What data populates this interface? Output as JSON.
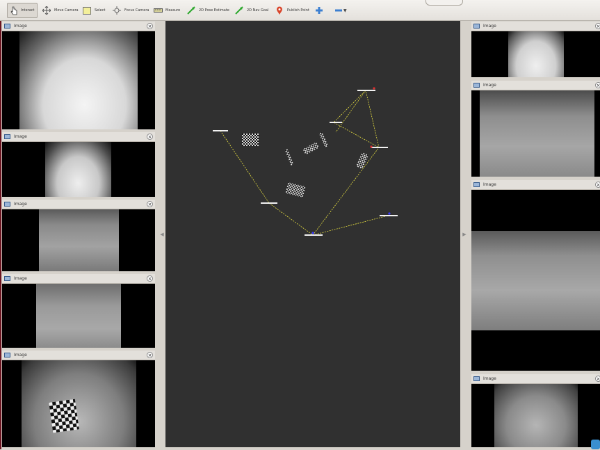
{
  "toolbar": {
    "tools": [
      {
        "label": "Interact",
        "icon": "hand-cursor-icon"
      },
      {
        "label": "Move Camera",
        "icon": "move-camera-icon"
      },
      {
        "label": "Select",
        "icon": "select-box-icon"
      },
      {
        "label": "Focus Camera",
        "icon": "focus-camera-icon"
      },
      {
        "label": "Measure",
        "icon": "ruler-icon"
      },
      {
        "label": "2D Pose Estimate",
        "icon": "green-arrow-icon"
      },
      {
        "label": "2D Nav Goal",
        "icon": "green-arrow-icon"
      },
      {
        "label": "Publish Point",
        "icon": "map-pin-icon"
      }
    ],
    "active": "Interact"
  },
  "panels": {
    "left": [
      {
        "title": "Image"
      },
      {
        "title": "Image"
      },
      {
        "title": "Image"
      },
      {
        "title": "Image"
      },
      {
        "title": "Image"
      }
    ],
    "right": [
      {
        "title": "Image"
      },
      {
        "title": "Image"
      },
      {
        "title": "Image"
      },
      {
        "title": "Image"
      }
    ]
  },
  "colors": {
    "viewport_bg": "#303030",
    "panel_title_bg": "#e3e0db",
    "trajectory": "#e8e040"
  }
}
